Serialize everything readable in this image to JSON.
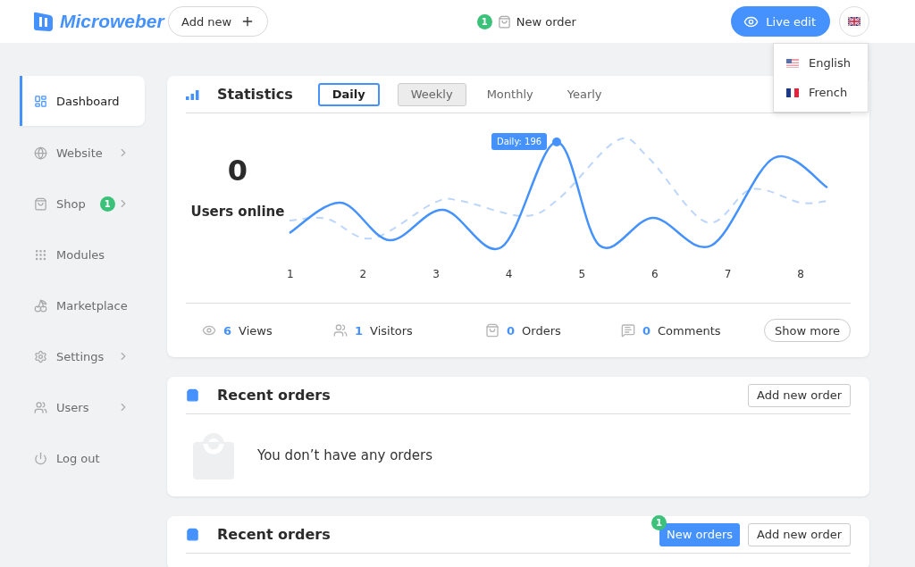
{
  "header": {
    "logo": "Microweber",
    "add_new": "Add new",
    "new_order": {
      "badge": "1",
      "label": "New order"
    },
    "live_edit": "Live edit"
  },
  "language_menu": {
    "open": true,
    "items": [
      {
        "label": "English",
        "kind": "us"
      },
      {
        "label": "French",
        "kind": "fr"
      }
    ]
  },
  "sidebar": {
    "items": [
      {
        "label": "Dashboard",
        "kind": "dashboard",
        "selected": true,
        "chevron": false
      },
      {
        "label": "Website",
        "kind": "globe",
        "selected": false,
        "chevron": true
      },
      {
        "label": "Shop",
        "kind": "bag",
        "selected": false,
        "chevron": true,
        "badge": "1"
      },
      {
        "label": "Modules",
        "kind": "grid",
        "selected": false,
        "chevron": false
      },
      {
        "label": "Marketplace",
        "kind": "cherry",
        "selected": false,
        "chevron": false
      },
      {
        "label": "Settings",
        "kind": "gear",
        "selected": false,
        "chevron": true
      },
      {
        "label": "Users",
        "kind": "users",
        "selected": false,
        "chevron": true
      },
      {
        "label": "Log out",
        "kind": "power",
        "selected": false,
        "chevron": false
      }
    ]
  },
  "statistics": {
    "title": "Statistics",
    "tabs": [
      {
        "label": "Daily",
        "selected": true,
        "hovered": false
      },
      {
        "label": "Weekly",
        "selected": false,
        "hovered": true
      },
      {
        "label": "Monthly",
        "selected": false,
        "hovered": false
      },
      {
        "label": "Yearly",
        "selected": false,
        "hovered": false
      }
    ],
    "users_online": {
      "value": "0",
      "label": "Users online"
    },
    "chart": {
      "tooltip": "Daily: 196",
      "x_labels": [
        "1",
        "2",
        "3",
        "4",
        "5",
        "6",
        "7",
        "8"
      ]
    },
    "summary": [
      {
        "kind": "eye",
        "value": "6",
        "label": "Views"
      },
      {
        "kind": "users",
        "value": "1",
        "label": "Visitors"
      },
      {
        "kind": "bag",
        "value": "0",
        "label": "Orders"
      },
      {
        "kind": "comment",
        "value": "0",
        "label": "Comments"
      }
    ],
    "show_more": "Show more"
  },
  "recent_orders": [
    {
      "title": "Recent orders",
      "add_button": "Add new order",
      "empty_text": "You don’t have any orders"
    },
    {
      "title": "Recent orders",
      "new_orders": {
        "label": "New orders",
        "badge": "1"
      },
      "add_button": "Add new order"
    }
  ]
}
